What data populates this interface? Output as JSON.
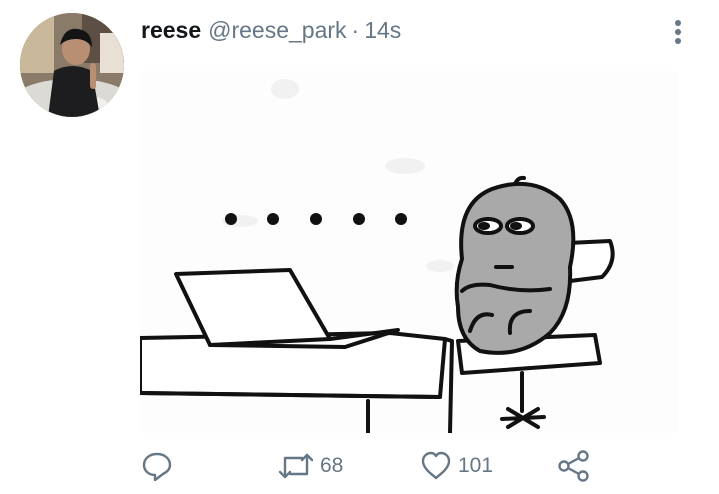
{
  "tweet": {
    "display_name": "reese",
    "handle": "@reese_park",
    "separator": "·",
    "time": "14s"
  },
  "icons": {
    "more": "more-vertical-icon",
    "reply": "reply-icon",
    "retweet": "retweet-icon",
    "like": "heart-icon",
    "share": "share-icon"
  },
  "actions": {
    "retweet_count": "68",
    "like_count": "101"
  },
  "colors": {
    "text": "#14171a",
    "secondary": "#657786",
    "background": "#ffffff"
  }
}
